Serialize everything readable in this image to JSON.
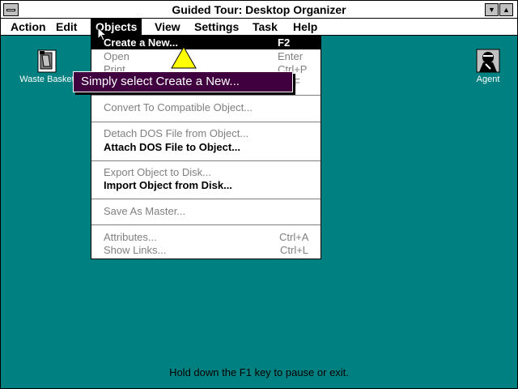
{
  "window": {
    "title": "Guided Tour: Desktop Organizer"
  },
  "menubar": {
    "items": [
      {
        "label": "Action"
      },
      {
        "label": "Edit"
      },
      {
        "label": "Objects"
      },
      {
        "label": "View"
      },
      {
        "label": "Settings"
      },
      {
        "label": "Task"
      },
      {
        "label": "Help"
      }
    ]
  },
  "objects_menu": {
    "items": [
      {
        "label": "Create a New...",
        "shortcut": "F2",
        "state": "highlighted"
      },
      {
        "label": "Open",
        "shortcut": "Enter",
        "state": "disabled"
      },
      {
        "label": "Print",
        "shortcut": "Ctrl+P",
        "state": "disabled"
      },
      {
        "label": "",
        "shortcut": "F",
        "state": "disabled"
      },
      {
        "label": "Convert To Compatible Object...",
        "shortcut": "",
        "state": "disabled"
      },
      {
        "label": "Detach DOS File from Object...",
        "shortcut": "",
        "state": "disabled"
      },
      {
        "label": "Attach DOS File to Object...",
        "shortcut": "",
        "state": "enabled"
      },
      {
        "label": "Export Object to Disk...",
        "shortcut": "",
        "state": "disabled"
      },
      {
        "label": "Import Object from Disk...",
        "shortcut": "",
        "state": "enabled"
      },
      {
        "label": "Save As Master...",
        "shortcut": "",
        "state": "disabled"
      },
      {
        "label": "Attributes...",
        "shortcut": "Ctrl+A",
        "state": "disabled"
      },
      {
        "label": "Show Links...",
        "shortcut": "Ctrl+L",
        "state": "disabled"
      }
    ]
  },
  "desktop": {
    "icons": [
      {
        "label": "Waste Basket",
        "icon": "waste-basket-icon"
      },
      {
        "label": "Agent",
        "icon": "agent-icon"
      }
    ]
  },
  "tooltip": {
    "text": "Simply select Create a New..."
  },
  "status": {
    "text": "Hold down the F1 key to pause or exit."
  },
  "colors": {
    "desktop": "#008080",
    "tooltip_bg": "#400040",
    "pointer": "#ffff00"
  }
}
